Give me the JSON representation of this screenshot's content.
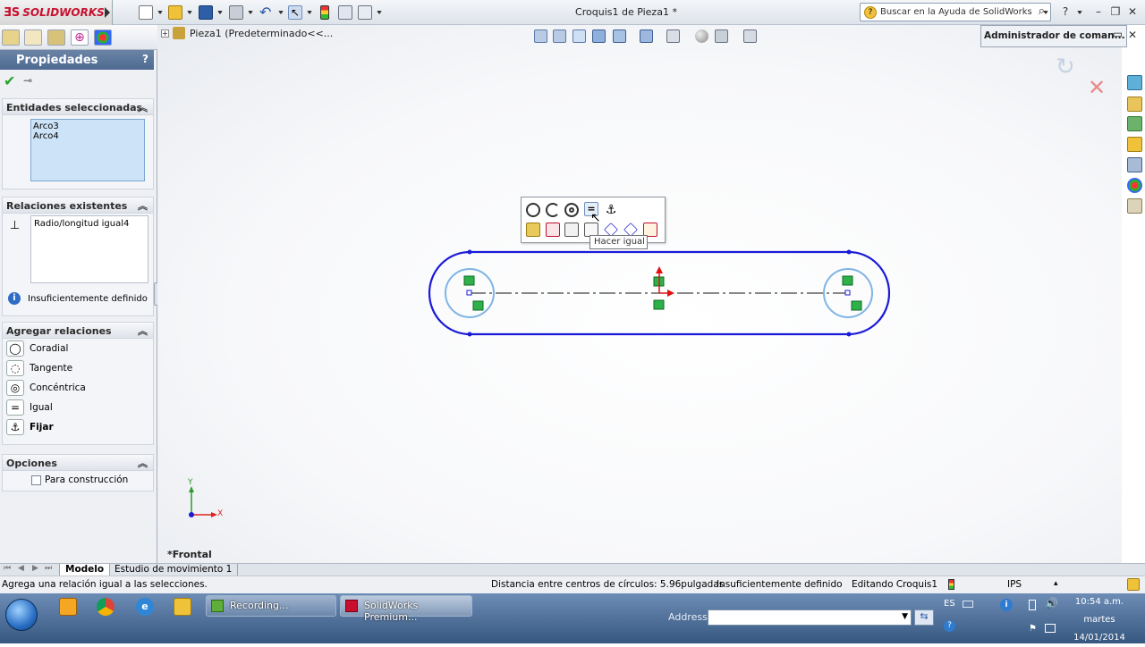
{
  "app": {
    "logo_text": "SOLIDWORKS",
    "window_title": "Croquis1 de Pieza1 *",
    "help_search_placeholder": "Buscar en la Ayuda de SolidWorks",
    "help_badge": "?"
  },
  "property_manager": {
    "title": "Propiedades",
    "help": "?",
    "selected_entities": {
      "label": "Entidades seleccionadas",
      "items": [
        "Arco3",
        "Arco4"
      ]
    },
    "existing_relations": {
      "label": "Relaciones existentes",
      "items": [
        "Radio/longitud igual4"
      ],
      "status": "Insuficientemente definido"
    },
    "add_relations": {
      "label": "Agregar relaciones",
      "items": [
        {
          "label": "Coradial",
          "icon": "coradial-icon"
        },
        {
          "label": "Tangente",
          "icon": "tangent-icon"
        },
        {
          "label": "Concéntrica",
          "icon": "concentric-icon"
        },
        {
          "label": "Igual",
          "icon": "equal-icon"
        },
        {
          "label": "Fijar",
          "icon": "fix-icon"
        }
      ]
    },
    "options": {
      "label": "Opciones",
      "construction_label": "Para construcción",
      "construction_checked": false
    }
  },
  "feature_tree": {
    "label": "Pieza1  (Predeterminado<<..."
  },
  "command_manager": {
    "label": "Administrador de coman..."
  },
  "viewport": {
    "view_name": "*Frontal",
    "tooltip": "Hacer igual",
    "triad_y": "Y",
    "triad_x": "X",
    "accent_sketch": "#1a1ad8",
    "accent_circle": "#7fb4e6",
    "accent_relation": "#2fb14a"
  },
  "bottom_tabs": {
    "model": "Modelo",
    "motion": "Estudio de movimiento 1"
  },
  "status_bar": {
    "message": "Agrega una relación igual a las selecciones.",
    "distance": "Distancia entre centros de círculos:  5.96pulgadas",
    "definition": "Insuficientemente definido",
    "editing": "Editando Croquis1",
    "units": "IPS"
  },
  "taskbar": {
    "task1": "Recording...",
    "task2": "SolidWorks Premium...",
    "address_label": "Address",
    "lang": "ES",
    "time": "10:54 a.m.",
    "day": "martes",
    "date": "14/01/2014"
  }
}
